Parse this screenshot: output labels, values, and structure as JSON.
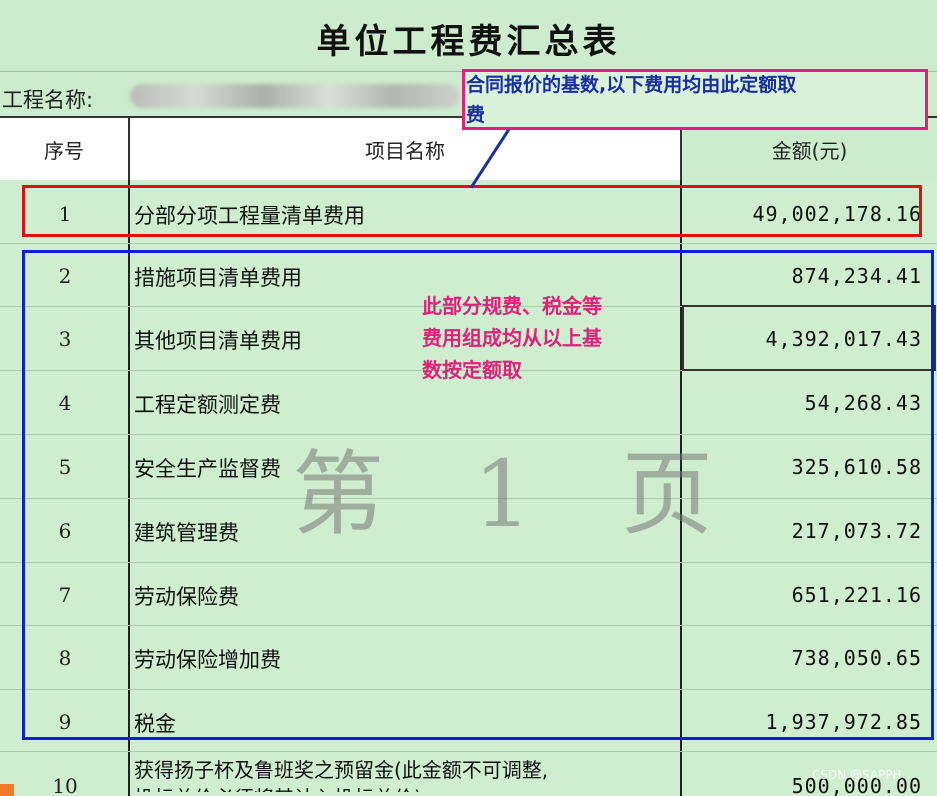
{
  "title": "单位工程费汇总表",
  "project_name_label": "工程名称:",
  "headers": {
    "num": "序号",
    "name": "项目名称",
    "amount": "金额(元)"
  },
  "rows": [
    {
      "num": "1",
      "name": "分部分项工程量清单费用",
      "amount": "49,002,178.16"
    },
    {
      "num": "2",
      "name": "措施项目清单费用",
      "amount": "874,234.41"
    },
    {
      "num": "3",
      "name": "其他项目清单费用",
      "amount": "4,392,017.43"
    },
    {
      "num": "4",
      "name": "工程定额测定费",
      "amount": "54,268.43"
    },
    {
      "num": "5",
      "name": "安全生产监督费",
      "amount": "325,610.58"
    },
    {
      "num": "6",
      "name": "建筑管理费",
      "amount": "217,073.72"
    },
    {
      "num": "7",
      "name": "劳动保险费",
      "amount": "651,221.16"
    },
    {
      "num": "8",
      "name": "劳动保险增加费",
      "amount": "738,050.65"
    },
    {
      "num": "9",
      "name": "税金",
      "amount": "1,937,972.85"
    },
    {
      "num": "10",
      "name_line1": "获得扬子杯及鲁班奖之预留金(此金额不可调整,",
      "name_line2": "投标总价必须将其计入投标总价)",
      "amount": "500,000.00"
    }
  ],
  "annotations": {
    "pink_line1": "合同报价的基数,以下费用均由此定额取",
    "pink_line2": "费",
    "blue_line1": "此部分规费、税金等",
    "blue_line2": "费用组成均从以上基",
    "blue_line3": "数按定额取"
  },
  "watermark": "第 1 页",
  "credit": "CSDN @SAPPH",
  "colors": {
    "sheet_bg": "#cfeecf",
    "red_box": "#e01010",
    "blue_box": "#1020d0",
    "pink_box": "#e0207a",
    "note_blue": "#1a2ea0"
  }
}
